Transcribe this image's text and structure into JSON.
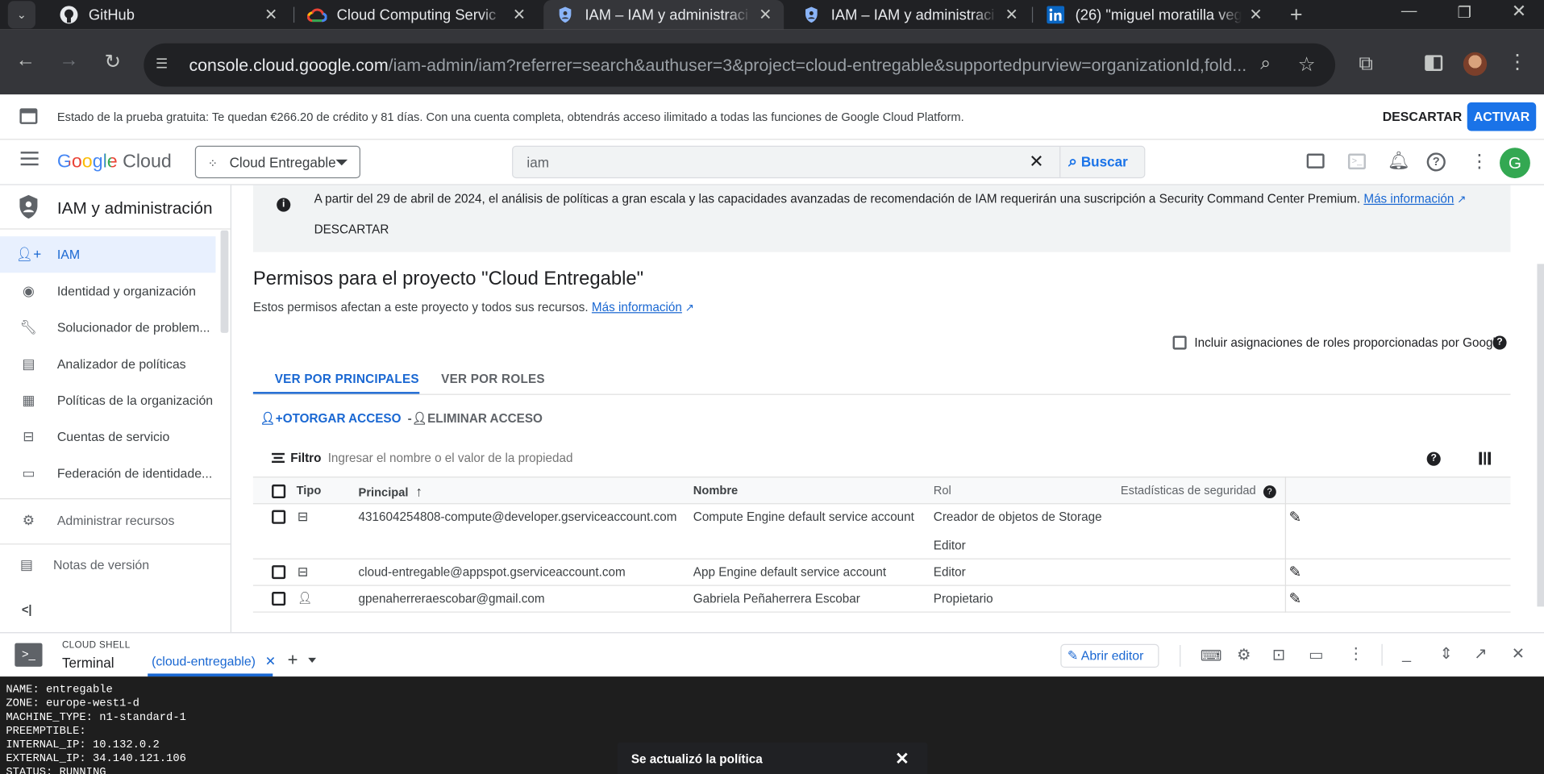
{
  "browser": {
    "tabs": [
      {
        "title": "GitHub",
        "icon": "github-icon"
      },
      {
        "title": "Cloud Computing Servic",
        "icon": "google-cloud-icon"
      },
      {
        "title": "IAM – IAM y administraci",
        "icon": "iam-shield-icon",
        "active": true
      },
      {
        "title": "IAM – IAM y administraci",
        "icon": "iam-shield-icon"
      },
      {
        "title": "(26) \"miguel moratilla veg",
        "icon": "linkedin-icon"
      }
    ],
    "url_host": "console.cloud.google.com",
    "url_path": "/iam-admin/iam?referrer=search&authuser=3&project=cloud-entregable&supportedpurview=organizationId,fold..."
  },
  "trial_banner": {
    "text": "Estado de la prueba gratuita: Te quedan €266.20 de crédito y 81 días. Con una cuenta completa, obtendrás acceso ilimitado a todas las funciones de Google Cloud Platform.",
    "dismiss_label": "DESCARTAR",
    "activate_label": "ACTIVAR"
  },
  "header": {
    "logo_google": "Google",
    "logo_cloud": "Cloud",
    "project": "Cloud Entregable",
    "search_value": "iam",
    "search_button": "Buscar",
    "avatar_letter": "G"
  },
  "sidebar": {
    "title": "IAM y administración",
    "items": [
      {
        "label": "IAM",
        "icon": "person-add-icon"
      },
      {
        "label": "Identidad y organización",
        "icon": "account-circle-icon"
      },
      {
        "label": "Solucionador de problem...",
        "icon": "wrench-icon"
      },
      {
        "label": "Analizador de políticas",
        "icon": "policy-doc-icon"
      },
      {
        "label": "Políticas de la organización",
        "icon": "article-icon"
      },
      {
        "label": "Cuentas de servicio",
        "icon": "service-account-icon"
      },
      {
        "label": "Federación de identidade...",
        "icon": "id-card-icon"
      }
    ],
    "manage_resources": "Administrar recursos",
    "release_notes": "Notas de versión",
    "collapse": "<|"
  },
  "notice": {
    "text": "A partir del 29 de abril de 2024, el análisis de políticas a gran escala y las capacidades avanzadas de recomendación de IAM requerirán una suscripción a Security Command Center Premium.",
    "link": "Más información",
    "dismiss": "DESCARTAR"
  },
  "main": {
    "title": "Permisos para el proyecto \"Cloud Entregable\"",
    "subtitle": "Estos permisos afectan a este proyecto y todos sus recursos.",
    "subtitle_link": "Más información",
    "include_google_roles": "Incluir asignaciones de roles proporcionadas por Google",
    "tabs": [
      "VER POR PRINCIPALES",
      "VER POR ROLES"
    ],
    "grant_access": "OTORGAR ACCESO",
    "remove_access": "ELIMINAR ACCESO",
    "filter_label": "Filtro",
    "filter_placeholder": "Ingresar el nombre o el valor de la propiedad"
  },
  "table": {
    "headers": {
      "type": "Tipo",
      "principal": "Principal",
      "name": "Nombre",
      "role": "Rol",
      "security": "Estadísticas de seguridad"
    },
    "rows": [
      {
        "type_icon": "service-account-icon",
        "principal": "431604254808-compute@developer.gserviceaccount.com",
        "name": "Compute Engine default service account",
        "roles": [
          "Creador de objetos de Storage",
          "Editor"
        ]
      },
      {
        "type_icon": "service-account-icon",
        "principal": "cloud-entregable@appspot.gserviceaccount.com",
        "name": "App Engine default service account",
        "roles": [
          "Editor"
        ]
      },
      {
        "type_icon": "person-icon",
        "principal": "gpenaherreraescobar@gmail.com",
        "name": "Gabriela Peñaherrera Escobar",
        "roles": [
          "Propietario"
        ]
      }
    ]
  },
  "cloud_shell": {
    "caption": "CLOUD SHELL",
    "title": "Terminal",
    "session_tab": "(cloud-entregable)",
    "open_editor": "Abrir editor",
    "terminal_lines": [
      "NAME: entregable",
      "ZONE: europe-west1-d",
      "MACHINE_TYPE: n1-standard-1",
      "PREEMPTIBLE:",
      "INTERNAL_IP: 10.132.0.2",
      "EXTERNAL_IP: 34.140.121.106",
      "STATUS: RUNNING"
    ]
  },
  "toast": {
    "text": "Se actualizó la política"
  },
  "colors": {
    "accent": "#1a73e8",
    "link": "#1967d2",
    "chrome_dark": "#202124",
    "chrome_toolbar": "#35363a",
    "terminal_bg": "#1e1e1e"
  }
}
